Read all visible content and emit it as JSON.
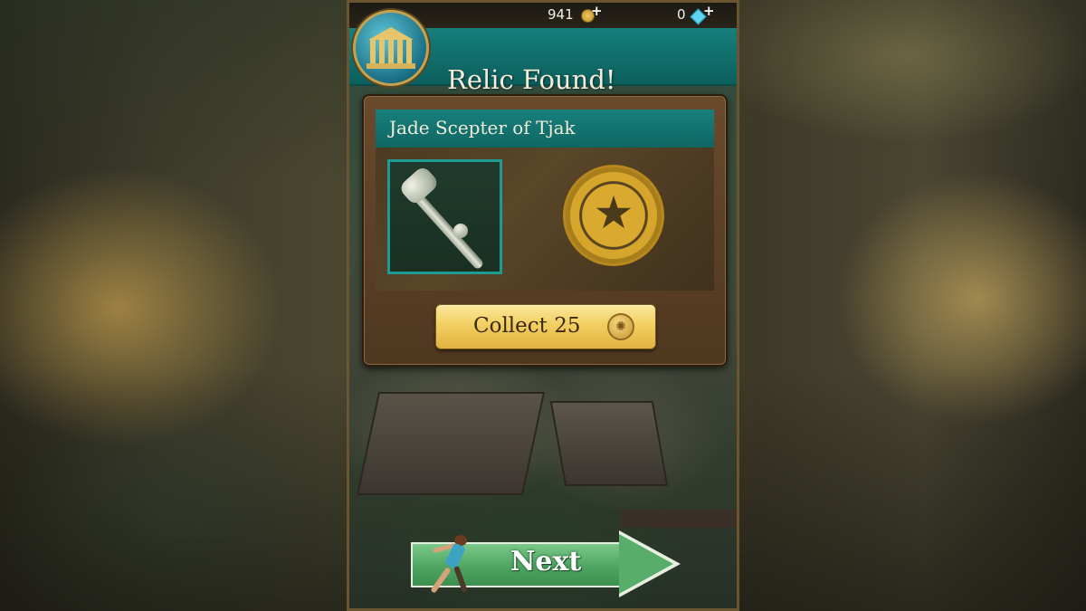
{
  "hud": {
    "coins": "941",
    "coin_plus": "+",
    "gems": "0",
    "gem_plus": "+"
  },
  "header": {
    "title": "Relic Found!",
    "badge_icon": "temple-icon"
  },
  "relic": {
    "name": "Jade Scepter of Tjak",
    "item_icon": "jade-scepter-icon",
    "seal_icon": "star-seal-icon"
  },
  "collect": {
    "label": "Collect 25",
    "coin_glyph": "✺",
    "coin_icon": "coin-icon"
  },
  "next": {
    "label": "Next"
  },
  "colors": {
    "teal_header": "#167f7c",
    "gold_button": "#f2cf62",
    "next_green": "#57ad69",
    "card_brown": "#6a4a2c"
  }
}
